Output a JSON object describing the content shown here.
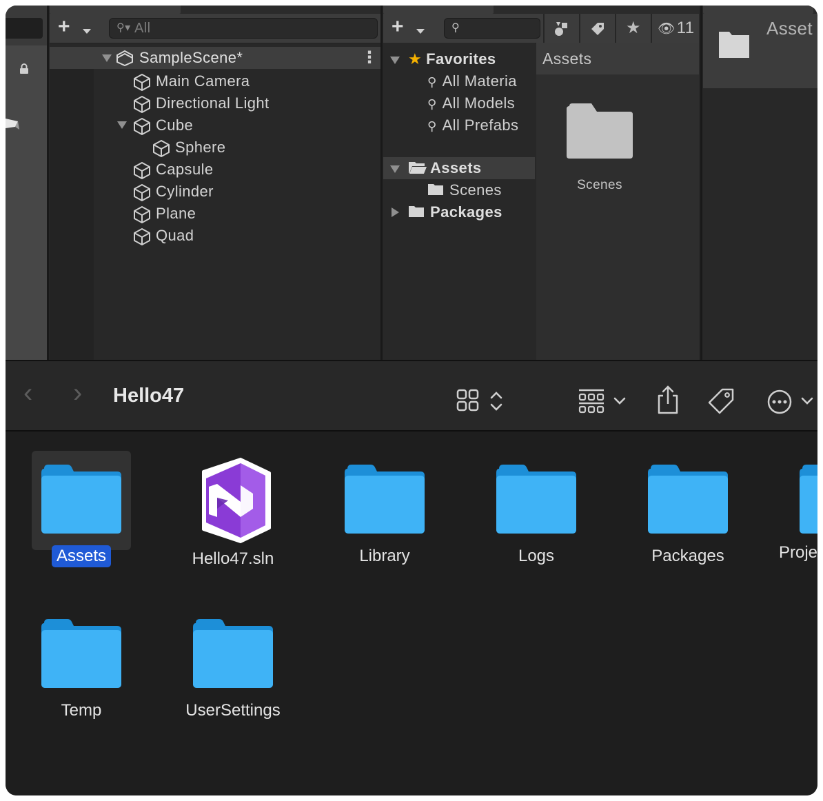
{
  "unity": {
    "hierarchy": {
      "search_placeholder": "All",
      "scene_name": "SampleScene*",
      "items": [
        {
          "label": "Main Camera"
        },
        {
          "label": "Directional Light"
        },
        {
          "label": "Cube"
        },
        {
          "label": "Sphere"
        },
        {
          "label": "Capsule"
        },
        {
          "label": "Cylinder"
        },
        {
          "label": "Plane"
        },
        {
          "label": "Quad"
        }
      ]
    },
    "project": {
      "hidden_count": "11",
      "favorites_label": "Favorites",
      "favorites": [
        {
          "label": "All Materia"
        },
        {
          "label": "All Models"
        },
        {
          "label": "All Prefabs"
        }
      ],
      "assets_label": "Assets",
      "scenes_label": "Scenes",
      "packages_label": "Packages",
      "grid_header": "Assets",
      "grid_items": [
        {
          "label": "Scenes"
        }
      ]
    },
    "inspector": {
      "title": "Asset"
    }
  },
  "finder": {
    "title": "Hello47",
    "items": [
      {
        "label": "Assets",
        "type": "folder",
        "selected": true
      },
      {
        "label": "Hello47.sln",
        "type": "visual-studio-solution"
      },
      {
        "label": "Library",
        "type": "folder"
      },
      {
        "label": "Logs",
        "type": "folder"
      },
      {
        "label": "Packages",
        "type": "folder"
      },
      {
        "label": "Proje",
        "type": "folder"
      },
      {
        "label": "Temp",
        "type": "folder"
      },
      {
        "label": "UserSettings",
        "type": "folder"
      }
    ]
  },
  "colors": {
    "folder_blue": "#35a9f0",
    "selection_blue": "#1f5ad6",
    "vs_purple": "#8a3bd6",
    "favorite_star": "#f5b100"
  }
}
